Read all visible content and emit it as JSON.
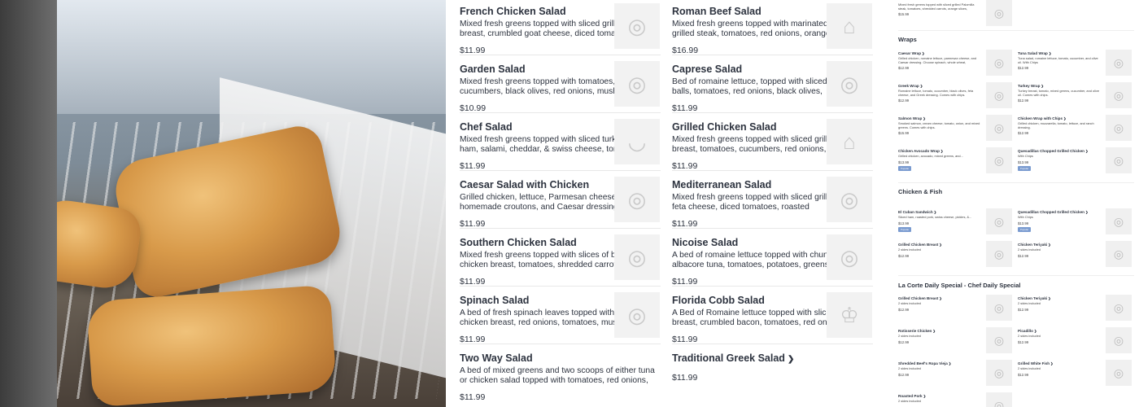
{
  "colors": {
    "text": "#2d333f",
    "thumb_bg": "#f2f2f2",
    "popular_badge": "#7a9bd0"
  },
  "hero": {
    "icon": "food-photo"
  },
  "menu": {
    "items": [
      {
        "title": "French Chicken Salad",
        "desc": "Mixed fresh greens topped with sliced grilled chicken breast, crumbled goat cheese, diced tomatoes,",
        "price": "$11.99",
        "icon": "plate-icon"
      },
      {
        "title": "Roman Beef Salad",
        "desc": "Mixed fresh greens topped with marinated sliced grilled steak, tomatoes, red onions, orange sections,",
        "price": "$16.99",
        "icon": "dish-icon"
      },
      {
        "title": "Garden Salad",
        "desc": "Mixed fresh greens topped with tomatoes, cucumbers, black olives, red onions, mushrooms,",
        "price": "$10.99",
        "icon": "plate-icon"
      },
      {
        "title": "Caprese Salad",
        "desc": "Bed of romaine lettuce, topped with sliced mozzarella balls, tomatoes, red onions, black olives,",
        "price": "$11.99",
        "icon": "plate-icon"
      },
      {
        "title": "Chef Salad",
        "desc": "Mixed fresh greens topped with sliced turkey breast, ham, salami, cheddar, & swiss cheese, tomatoes, red",
        "price": "$11.99",
        "icon": "bowl-icon"
      },
      {
        "title": "Grilled Chicken Salad",
        "desc": "Mixed fresh greens topped with sliced grilled chicken breast, tomatoes, cucumbers, red onions, black",
        "price": "$11.99",
        "icon": "dish-icon"
      },
      {
        "title": "Caesar Salad with Chicken",
        "desc": "Grilled chicken, lettuce, Parmesan cheese, homemade croutons, and Caesar dressing.",
        "price": "$11.99",
        "icon": "plate-icon"
      },
      {
        "title": "Mediterranean Salad",
        "desc": "Mixed fresh greens topped with sliced grilled chicken, feta cheese, diced tomatoes, roasted",
        "price": "$11.99",
        "icon": "plate-icon"
      },
      {
        "title": "Southern Chicken Salad",
        "desc": "Mixed fresh greens topped with slices of breaded chicken breast, tomatoes, shredded carrots, orange",
        "price": "$11.99",
        "icon": "plate-icon"
      },
      {
        "title": "Nicoise Salad",
        "desc": "A bed of romaine lettuce topped with chunks of albacore tuna, tomatoes, potatoes, greens beans,",
        "price": "$11.99",
        "icon": "plate-icon"
      },
      {
        "title": "Spinach Salad",
        "desc": "A bed of fresh spinach leaves topped with sliced chicken breast, red onions, tomatoes, mushrooms,",
        "price": "$11.99",
        "icon": "plate-icon"
      },
      {
        "title": "Florida Cobb Salad",
        "desc": "A Bed of Romaine lettuce topped with sliced Turkey breast, crumbled bacon, tomatoes, red onions,",
        "price": "$11.99",
        "icon": "chef-icon"
      },
      {
        "title": "Two Way Salad",
        "desc": "A bed of mixed greens and two scoops of either tuna or chicken salad topped with tomatoes, red onions,",
        "price": "$11.99",
        "icon": ""
      },
      {
        "title": "Traditional Greek Salad",
        "desc": "",
        "price": "$11.99",
        "icon": ""
      }
    ]
  },
  "right": {
    "top_item": {
      "desc": "Mixed fresh greens topped with sliced grilled Palomilla steak, tomatoes, shredded carrots, orange slices,",
      "price": "$15.99"
    },
    "wraps_title": "Wraps",
    "wraps": [
      {
        "title": "Caesar Wrap",
        "desc": "Grilled chicken, romaine lettuce, parmesan cheese, and Caesar dressing. Choose spinach, whole wheat,",
        "price": "$12.99"
      },
      {
        "title": "Tuna Salad Wrap",
        "desc": "Tuna salad, romaine lettuce, tomato, cucumber, and olive oil. With Chips",
        "price": "$12.99"
      },
      {
        "title": "Greek Wrap",
        "desc": "Romaine lettuce, tomato, cucumber, black olives, feta cheese, and Greek dressing. Comes with chips.",
        "price": "$12.99"
      },
      {
        "title": "Turkey Wrap",
        "desc": "Turkey breast, tomato, mixed greens, cucumber, and olive oil. Comes with chips.",
        "price": "$12.99"
      },
      {
        "title": "Salmon Wrap",
        "desc": "Smoked salmon, cream cheese, tomato, onion, and mixed greens. Comes with chips.",
        "price": "$15.99"
      },
      {
        "title": "Chicken Wrap with Chips",
        "desc": "Grilled chicken, mozzarella, tomato, lettuce, and ranch dressing.",
        "price": "$12.99"
      },
      {
        "title": "Chicken Avocado Wrap",
        "desc": "Grilled chicken, avocado, mixed greens, and...",
        "price": "$13.99",
        "badge": "Popular"
      },
      {
        "title": "Quesadillas Chopped Grilled Chicken",
        "desc": "With Chips",
        "price": "$13.99",
        "badge": "Popular"
      }
    ],
    "chicken_fish_title": "Chicken & Fish",
    "chicken_fish": [
      {
        "title": "El Cuban Sandwich",
        "desc": "Sliced ham, roasted pork, swiss cheese, pickles, &...",
        "price": "$13.99",
        "badge": "Popular"
      },
      {
        "title": "Quesadillas Chopped Grilled Chicken",
        "desc": "With Chips",
        "price": "$13.99",
        "badge": "Popular"
      },
      {
        "title": "Grilled Chicken Breast",
        "desc": "2 sides included",
        "price": "$12.99"
      },
      {
        "title": "Chicken Teriyaki",
        "desc": "2 sides included",
        "price": "$12.99"
      }
    ],
    "special_title": "La Corte Daily Special - Chef Daily Special",
    "special": [
      {
        "title": "Grilled Chicken Breast",
        "desc": "2 sides included",
        "price": "$12.99"
      },
      {
        "title": "Chicken Teriyaki",
        "desc": "2 sides included",
        "price": "$12.99"
      },
      {
        "title": "Rotisserie Chicken",
        "desc": "2 sides included",
        "price": "$12.99"
      },
      {
        "title": "Picadillo",
        "desc": "2 sides included",
        "price": "$12.99"
      },
      {
        "title": "Shredded Beef's Ropa Vieja",
        "desc": "2 sides included",
        "price": "$12.99"
      },
      {
        "title": "Grilled White Fish",
        "desc": "2 sides included",
        "price": "$12.99"
      },
      {
        "title": "Roasted Pork",
        "desc": "2 sides included",
        "price": ""
      }
    ]
  }
}
